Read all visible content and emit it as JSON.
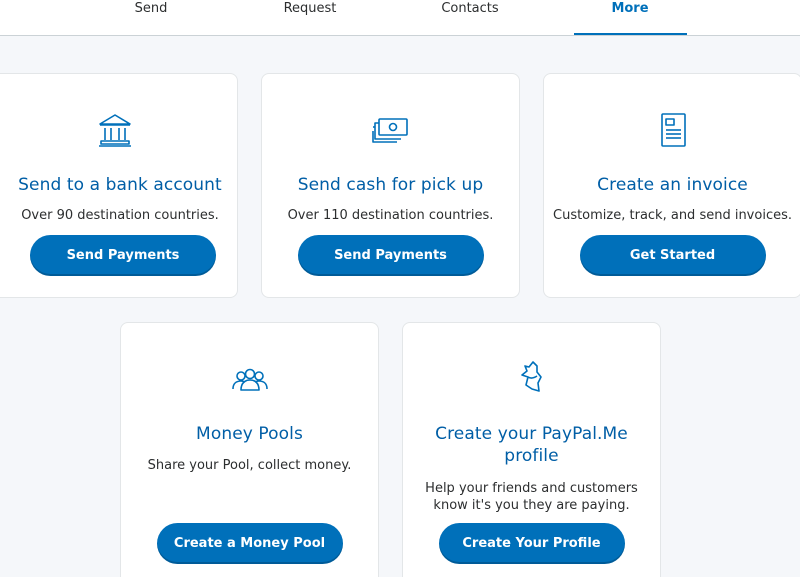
{
  "nav": {
    "items": [
      {
        "label": "Send"
      },
      {
        "label": "Request"
      },
      {
        "label": "Contacts"
      },
      {
        "label": "More",
        "active": true
      }
    ]
  },
  "cards": [
    {
      "icon": "bank-icon",
      "title": "Send to a bank account",
      "description": "Over 90 destination countries.",
      "button": "Send Payments"
    },
    {
      "icon": "cash-icon",
      "title": "Send cash for pick up",
      "description": "Over 110 destination countries.",
      "button": "Send Payments"
    },
    {
      "icon": "invoice-icon",
      "title": "Create an invoice",
      "description": "Customize, track, and send invoices.",
      "button": "Get Started"
    },
    {
      "icon": "people-group-icon",
      "title": "Money Pools",
      "description": "Share your Pool, collect money.",
      "button": "Create a Money Pool"
    },
    {
      "icon": "paypal-me-icon",
      "title_line1": "Create your PayPal.Me",
      "title_line2": "profile",
      "description_line1": "Help your friends and customers",
      "description_line2": "know it's you they are paying.",
      "button": "Create Your Profile"
    }
  ],
  "colors": {
    "accent": "#0070ba",
    "title": "#005ea6",
    "background": "#f5f7fa"
  }
}
